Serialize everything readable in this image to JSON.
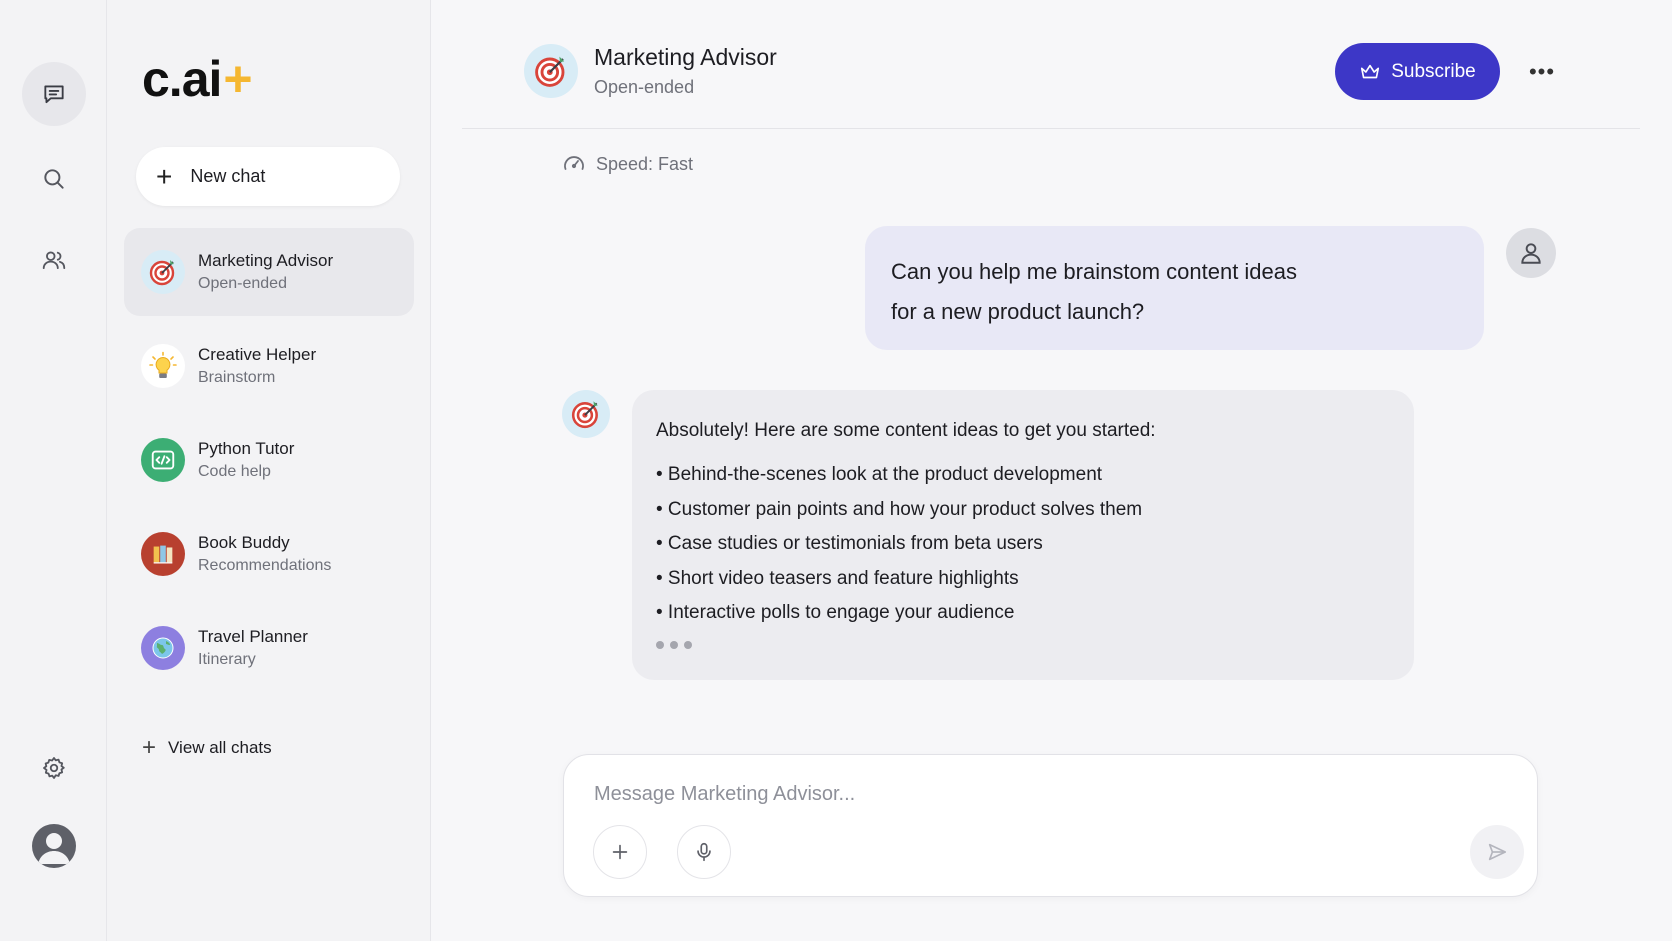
{
  "app": {
    "logo_text": "c.ai",
    "logo_plus": "+"
  },
  "rail": {
    "items": [
      {
        "name": "chats",
        "icon": "chat-bubble-icon",
        "active": true
      },
      {
        "name": "search",
        "icon": "search-icon"
      },
      {
        "name": "community",
        "icon": "users-icon"
      }
    ],
    "bottom": [
      {
        "name": "settings",
        "icon": "gear-icon"
      },
      {
        "name": "profile",
        "icon": "avatar-icon"
      }
    ]
  },
  "sidebar": {
    "new_chat_label": "New chat",
    "chats": [
      {
        "name": "Marketing Advisor",
        "subtitle": "Open-ended",
        "icon": "target-icon",
        "active": true
      },
      {
        "name": "Creative Helper",
        "subtitle": "Brainstorm",
        "icon": "lightbulb-icon"
      },
      {
        "name": "Python Tutor",
        "subtitle": "Code help",
        "icon": "code-icon"
      },
      {
        "name": "Book Buddy",
        "subtitle": "Recommendations",
        "icon": "books-icon"
      },
      {
        "name": "Travel Planner",
        "subtitle": "Itinerary",
        "icon": "globe-icon"
      }
    ],
    "view_all_label": "View all chats"
  },
  "header": {
    "title": "Marketing Advisor",
    "subtitle": "Open-ended",
    "subscribe_label": "Subscribe",
    "more_label": "•••"
  },
  "conversation": {
    "speed_label": "Speed: Fast",
    "user_message_lines": [
      "Can you help me brainstom content ideas",
      "for a new product launch?"
    ],
    "bot_message": {
      "intro": "Absolutely! Here are some content ideas to get you started:",
      "items": [
        "• Behind-the-scenes look at the product development",
        "• Customer pain points and how your product solves them",
        "• Case studies or testimonials from beta users",
        "• Short video teasers and feature highlights",
        "• Interactive polls to engage your audience"
      ],
      "typing": true
    }
  },
  "composer": {
    "placeholder": "Message Marketing Advisor...",
    "value": ""
  },
  "colors": {
    "accent": "#3d37c7",
    "logo_plus": "#f5b731",
    "user_bubble": "#e8e8f6",
    "bot_bubble": "#ececf0"
  }
}
